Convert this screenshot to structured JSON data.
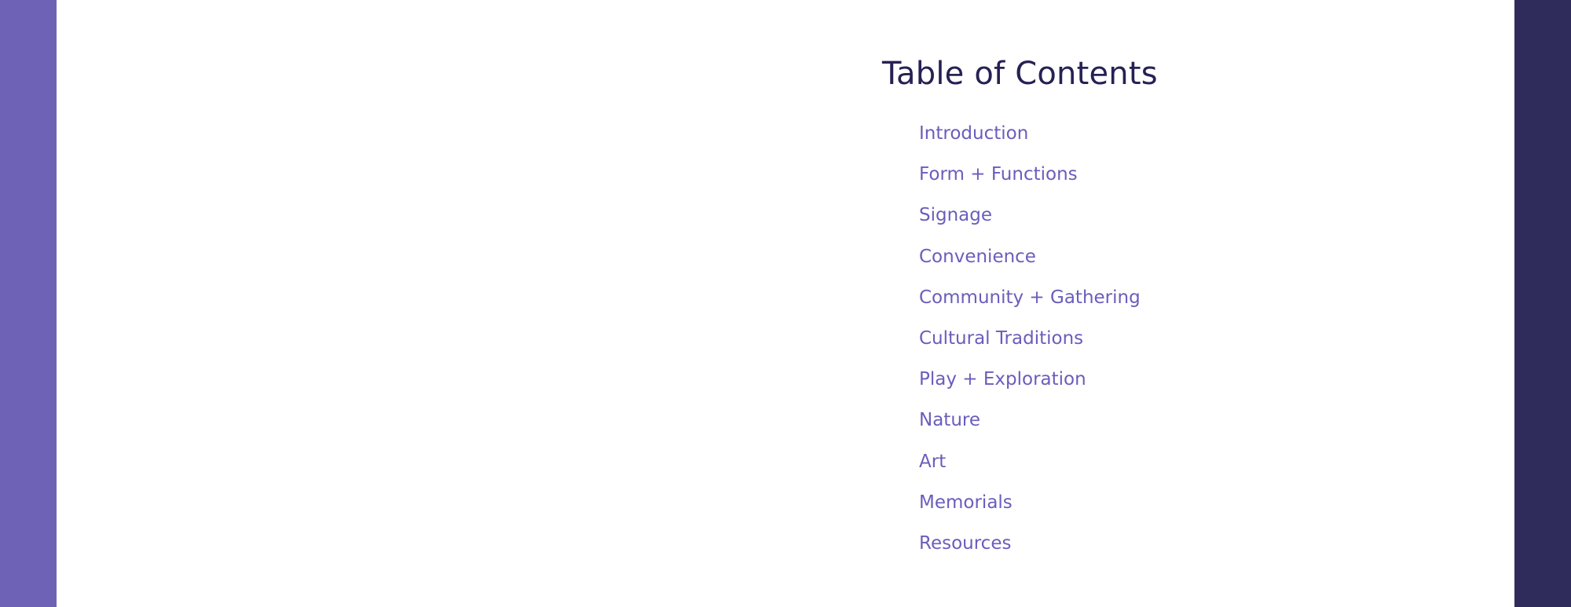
{
  "colors": {
    "left_bar": "#6e62b6",
    "right_bar": "#2f2c5c",
    "title": "#262154",
    "link": "#6a5dbc",
    "background": "#ffffff"
  },
  "toc": {
    "title": "Table of Contents",
    "items": [
      {
        "label": "Introduction"
      },
      {
        "label": "Form + Functions"
      },
      {
        "label": "Signage"
      },
      {
        "label": "Convenience"
      },
      {
        "label": "Community + Gathering"
      },
      {
        "label": "Cultural Traditions"
      },
      {
        "label": "Play + Exploration"
      },
      {
        "label": "Nature"
      },
      {
        "label": "Art"
      },
      {
        "label": "Memorials"
      },
      {
        "label": "Resources"
      }
    ]
  }
}
